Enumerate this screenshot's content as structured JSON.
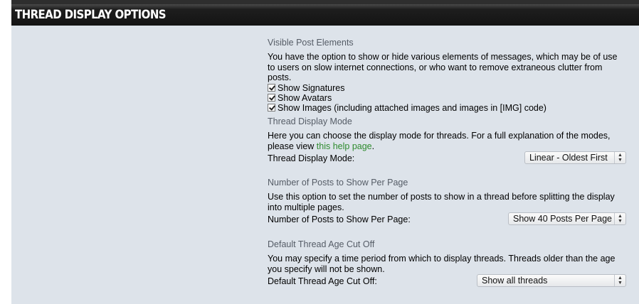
{
  "header": {
    "title": "THREAD DISPLAY OPTIONS"
  },
  "sections": {
    "visible": {
      "title": "Visible Post Elements",
      "description": "You have the option to show or hide various elements of messages, which may be of use to users on slow internet connections, or who want to remove extraneous clutter from posts.",
      "options": [
        {
          "label": "Show Signatures",
          "checked": true
        },
        {
          "label": "Show Avatars",
          "checked": true
        },
        {
          "label": "Show Images (including attached images and images in [IMG] code)",
          "checked": true
        }
      ]
    },
    "mode": {
      "title": "Thread Display Mode",
      "description_before": "Here you can choose the display mode for threads. For a full explanation of the modes, please view ",
      "link_text": "this help page",
      "description_after": ".",
      "field_label": "Thread Display Mode:",
      "selected": "Linear - Oldest First"
    },
    "posts": {
      "title": "Number of Posts to Show Per Page",
      "description": "Use this option to set the number of posts to show in a thread before splitting the display into multiple pages.",
      "field_label": "Number of Posts to Show Per Page:",
      "selected": "Show 40 Posts Per Page"
    },
    "age": {
      "title": "Default Thread Age Cut Off",
      "description": "You may specify a time period from which to display threads. Threads older than the age you specify will not be shown.",
      "field_label": "Default Thread Age Cut Off:",
      "selected": "Show all threads"
    }
  },
  "icons": {
    "select_arrows": "up-down-arrows-icon",
    "checkbox": "check-icon"
  }
}
